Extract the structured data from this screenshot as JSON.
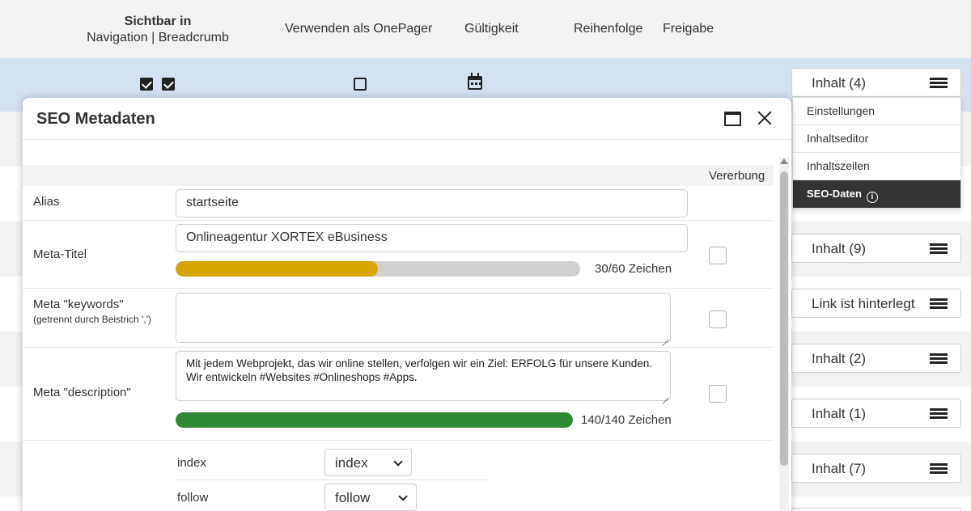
{
  "table_header": {
    "visible_title": "Sichtbar in",
    "visible_sub": "Navigation | Breadcrumb",
    "onepager": "Verwenden als OnePager",
    "validity": "Gültigkeit",
    "order": "Reihenfolge",
    "release": "Freigabe"
  },
  "row_controls": {
    "nav_checked": true,
    "breadcrumb_checked": true,
    "onepager_checked": false
  },
  "content_buttons": [
    {
      "label": "Inhalt (4)"
    },
    {
      "label": "Inhalt (9)"
    },
    {
      "label": "Link ist hinterlegt"
    },
    {
      "label": "Inhalt (2)"
    },
    {
      "label": "Inhalt (1)"
    },
    {
      "label": "Inhalt (7)"
    }
  ],
  "context_menu": {
    "items": [
      "Einstellungen",
      "Inhaltseditor",
      "Inhaltszeilen"
    ],
    "active_item": "SEO-Daten",
    "info_glyph": "i"
  },
  "modal": {
    "title": "SEO Metadaten",
    "inherit_header": "Vererbung",
    "alias": {
      "label": "Alias",
      "value": "startseite"
    },
    "meta_title": {
      "label": "Meta-Titel",
      "value": "Onlineagentur XORTEX eBusiness",
      "progress": 0.5,
      "progress_color": "#d9a500",
      "counter": "30/60 Zeichen",
      "inherit": false
    },
    "keywords": {
      "label": "Meta \"keywords\"",
      "sub": "(getrennt durch Beistrich ',')",
      "value": "",
      "inherit": false
    },
    "description": {
      "label": "Meta \"description\"",
      "value": "Mit jedem Webprojekt, das wir online stellen, verfolgen wir ein Ziel: ERFOLG für unsere Kunden. Wir entwickeln #Websites #Onlineshops #Apps.",
      "progress": 1.0,
      "progress_color": "#2e8b35",
      "counter": "140/140 Zeichen",
      "inherit": false
    },
    "robots": {
      "index_label": "index",
      "index_value": "index",
      "follow_label": "follow",
      "follow_value": "follow"
    }
  },
  "colors": {
    "selected_row": "#d4e1f1",
    "menu_active": "#333333"
  }
}
